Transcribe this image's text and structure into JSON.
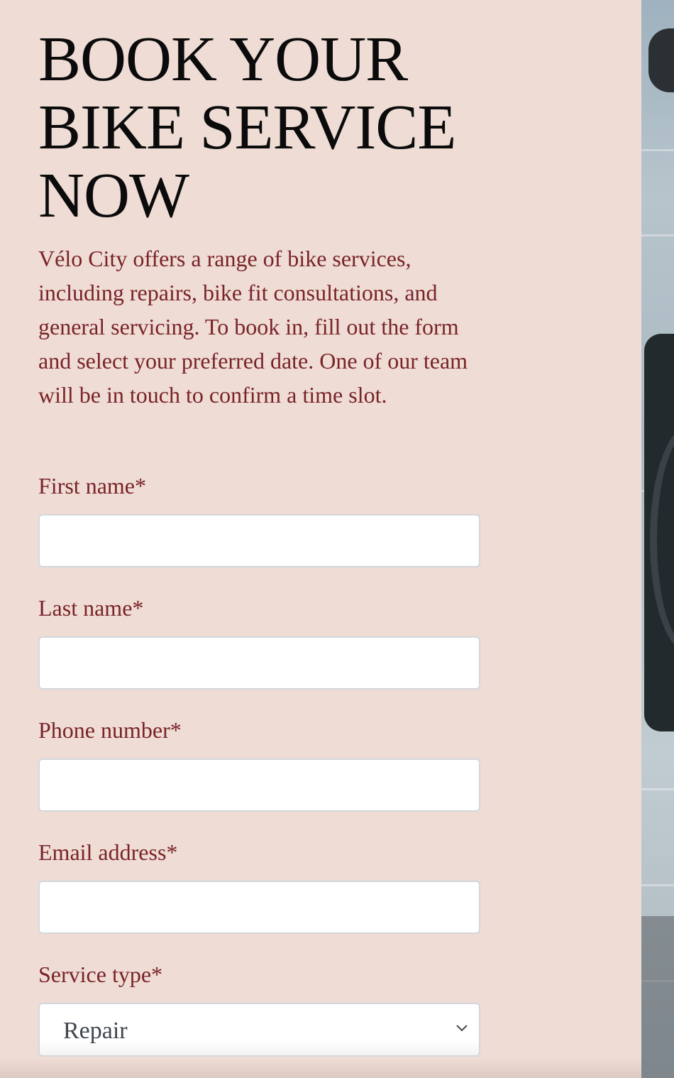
{
  "page": {
    "heading": "BOOK YOUR BIKE SERVICE NOW",
    "intro": "Vélo City offers a range of bike services, including repairs, bike fit consultations, and general servicing. To book in, fill out the form and select your preferred date. One of our team will be in touch to confirm a time slot."
  },
  "form": {
    "first_name": {
      "label": "First name*",
      "value": ""
    },
    "last_name": {
      "label": "Last name*",
      "value": ""
    },
    "phone": {
      "label": "Phone number*",
      "value": ""
    },
    "email": {
      "label": "Email address*",
      "value": ""
    },
    "service_type": {
      "label": "Service type*",
      "selected": "Repair"
    }
  },
  "colors": {
    "background": "#eedcd5",
    "heading": "#0b0b0b",
    "accent_text": "#7a2327",
    "input_border": "#d3d7dc"
  },
  "icons": {
    "select_arrow": "chevron-down-icon"
  }
}
